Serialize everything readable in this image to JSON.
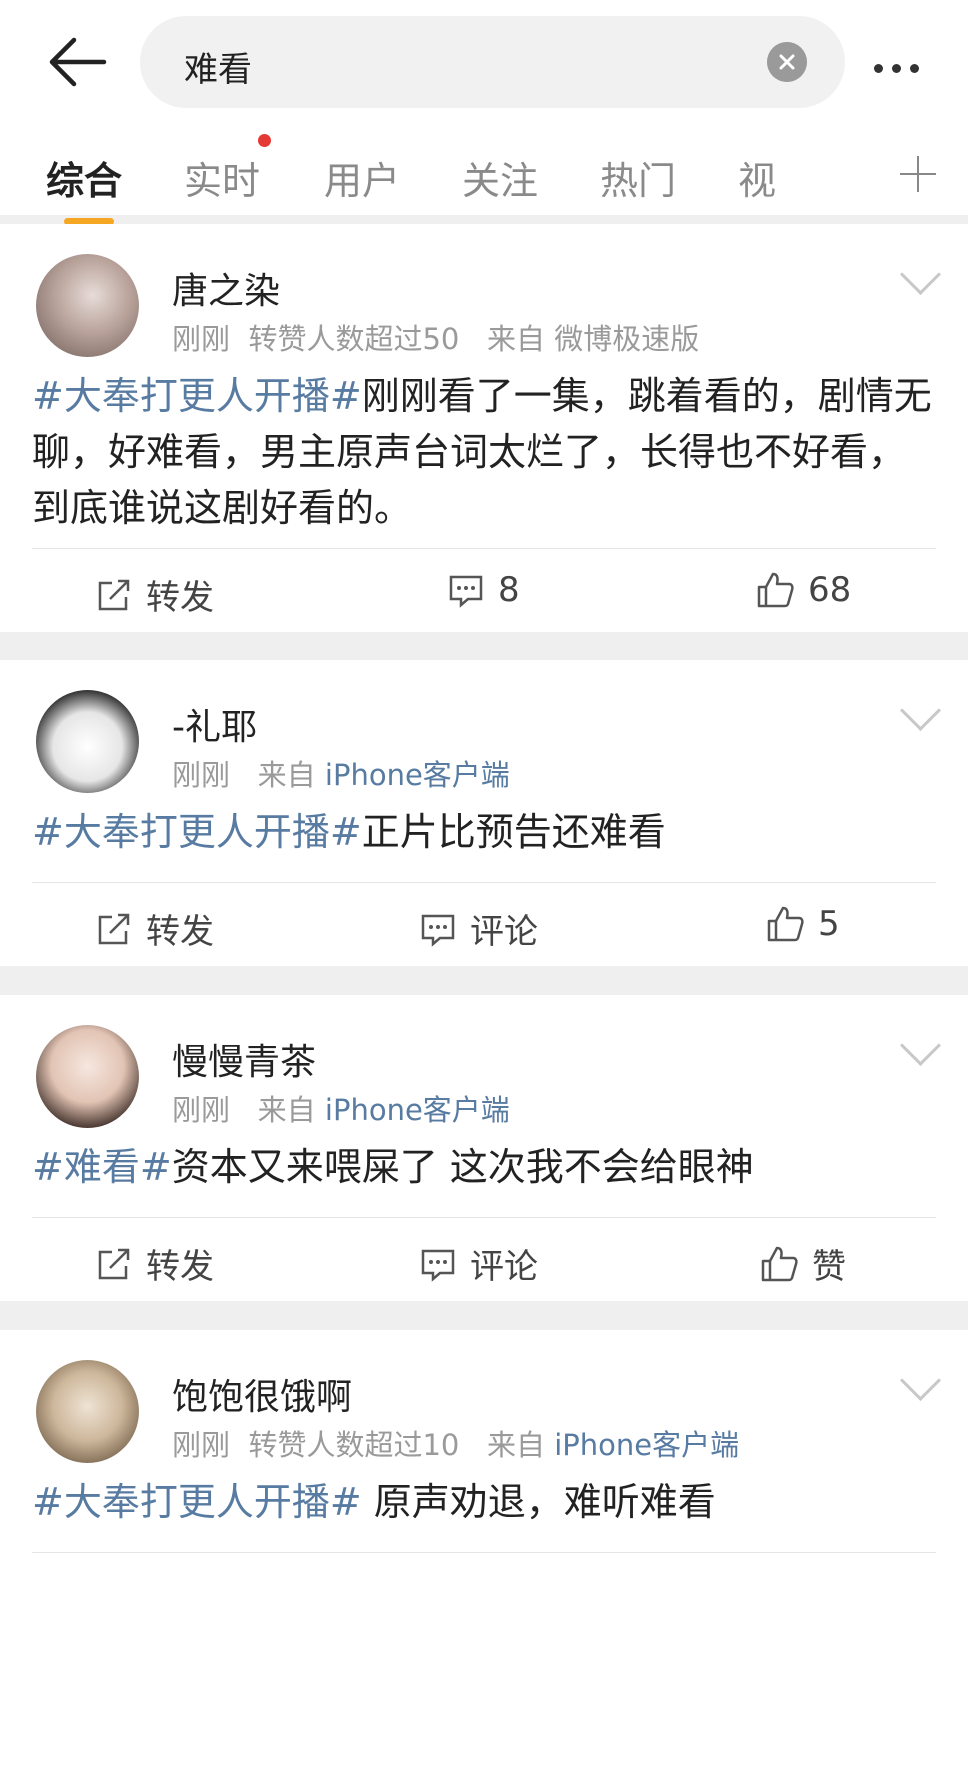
{
  "search": {
    "query": "难看"
  },
  "tabs": [
    "综合",
    "实时",
    "用户",
    "关注",
    "热门",
    "视"
  ],
  "posts": [
    {
      "user": "唐之染",
      "time": "刚刚",
      "extra": "转赞人数超过50",
      "from_label": "来自",
      "source": "微博极速版",
      "tag": "#大奉打更人开播#",
      "text": "刚刚看了一集，跳着看的，剧情无聊，好难看，男主原声台词太烂了，长得也不好看，到底谁说这剧好看的。",
      "repost": "转发",
      "comment": "8",
      "like": "68"
    },
    {
      "user": "-礼耶",
      "time": "刚刚",
      "extra": "",
      "from_label": "来自",
      "source": "iPhone客户端",
      "tag": "#大奉打更人开播#",
      "text": "正片比预告还难看",
      "repost": "转发",
      "comment": "评论",
      "like": "5"
    },
    {
      "user": "慢慢青茶",
      "time": "刚刚",
      "extra": "",
      "from_label": "来自",
      "source": "iPhone客户端",
      "tag": "#难看#",
      "text": "资本又来喂屎了 这次我不会给眼神",
      "repost": "转发",
      "comment": "评论",
      "like": "赞"
    },
    {
      "user": "饱饱很饿啊",
      "time": "刚刚",
      "extra": "转赞人数超过10",
      "from_label": "来自",
      "source": "iPhone客户端",
      "tag": "#大奉打更人开播#",
      "text": " 原声劝退，难听难看"
    }
  ]
}
